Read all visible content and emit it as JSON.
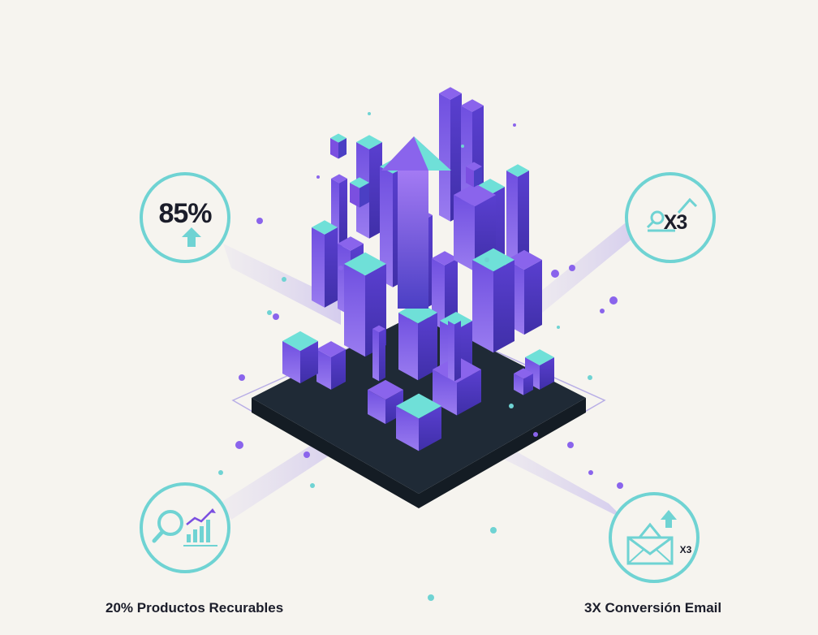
{
  "stats": {
    "top_left_value": "85%",
    "top_right_value": "X3",
    "bottom_right_multiplier": "X3"
  },
  "captions": {
    "left": "20% Productos Recurables",
    "right": "3X Conversión Email"
  },
  "colors": {
    "background": "#f6f4ef",
    "teal": "#6fd3d3",
    "purple": "#7b4fe0",
    "dark_base": "#1c2530"
  }
}
